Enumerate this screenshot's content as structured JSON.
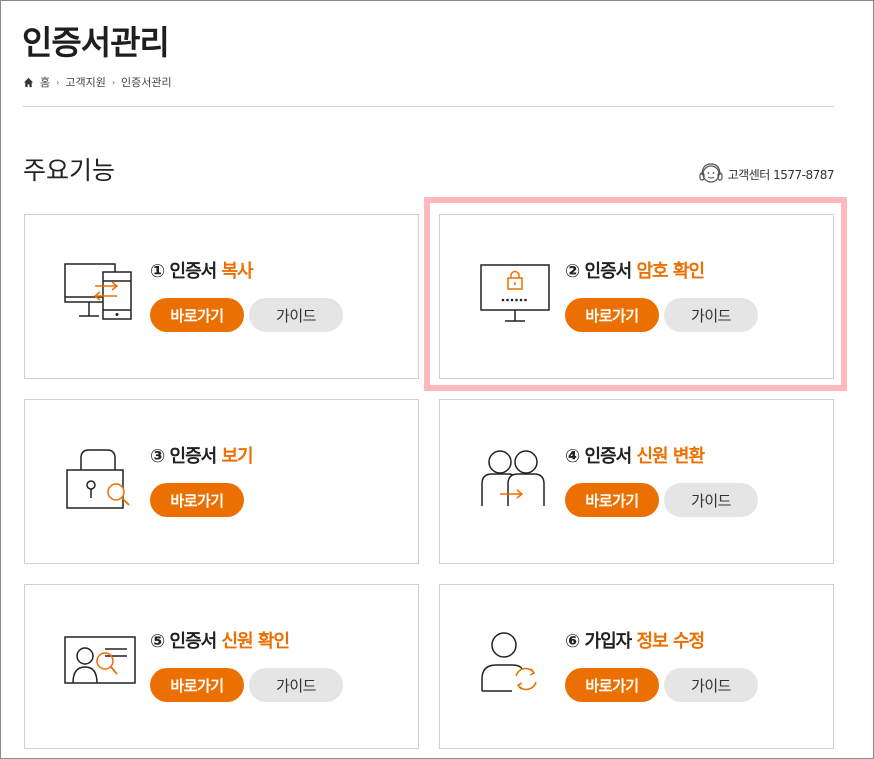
{
  "page": {
    "title": "인증서관리",
    "breadcrumb": [
      "홈",
      "고객지원",
      "인증서관리"
    ],
    "section_title": "주요기능",
    "call_center": "고객센터 1577-8787"
  },
  "colors": {
    "accent": "#ec7001",
    "guide_bg": "#e5e5e5",
    "highlight": "#ffb9bd"
  },
  "cards": [
    {
      "num": "①",
      "title_prefix": "인증서",
      "title_hl": "복사",
      "go_label": "바로가기",
      "guide_label": "가이드",
      "icon": "monitor-copy-icon"
    },
    {
      "num": "②",
      "title_prefix": "인증서",
      "title_hl": "암호 확인",
      "go_label": "바로가기",
      "guide_label": "가이드",
      "icon": "monitor-lock-icon"
    },
    {
      "num": "③",
      "title_prefix": "인증서",
      "title_hl": "보기",
      "go_label": "바로가기",
      "icon": "lock-search-icon"
    },
    {
      "num": "④",
      "title_prefix": "인증서",
      "title_hl": "신원 변환",
      "go_label": "바로가기",
      "guide_label": "가이드",
      "icon": "users-transfer-icon"
    },
    {
      "num": "⑤",
      "title_prefix": "인증서",
      "title_hl": "신원 확인",
      "go_label": "바로가기",
      "guide_label": "가이드",
      "icon": "id-card-search-icon"
    },
    {
      "num": "⑥",
      "title_prefix": "가입자",
      "title_hl": "정보 수정",
      "go_label": "바로가기",
      "guide_label": "가이드",
      "icon": "user-refresh-icon"
    }
  ]
}
